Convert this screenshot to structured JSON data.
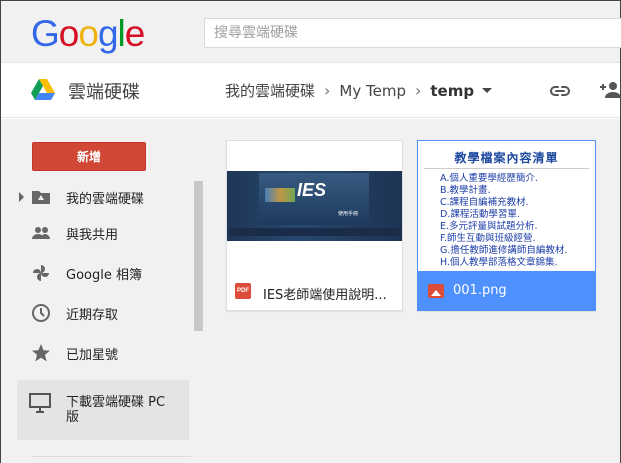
{
  "header": {
    "logo_letters": [
      {
        "ch": "G",
        "color": "#3369e8"
      },
      {
        "ch": "o",
        "color": "#d50f25"
      },
      {
        "ch": "o",
        "color": "#eeb211"
      },
      {
        "ch": "g",
        "color": "#3369e8"
      },
      {
        "ch": "l",
        "color": "#009925"
      },
      {
        "ch": "e",
        "color": "#d50f25"
      }
    ],
    "search_placeholder": "搜尋雲端硬碟"
  },
  "appbar": {
    "title": "雲端硬碟",
    "breadcrumbs": [
      "我的雲端硬碟",
      "My Temp",
      "temp"
    ],
    "link_icon": "link-icon",
    "share_icon": "person-add-icon"
  },
  "sidebar": {
    "new_label": "新增",
    "items": [
      {
        "label": "我的雲端硬碟",
        "icon": "folder-drive-icon"
      },
      {
        "label": "與我共用",
        "icon": "people-icon"
      },
      {
        "label": "Google 相簿",
        "icon": "pinwheel-icon"
      },
      {
        "label": "近期存取",
        "icon": "clock-icon"
      },
      {
        "label": "已加星號",
        "icon": "star-icon"
      }
    ],
    "download_label": "下載雲端硬碟 PC 版",
    "download_icon": "monitor-icon"
  },
  "files": [
    {
      "name": "IES老師端使用說明...",
      "type_badge": "PDF",
      "thumb": {
        "brand": "IES",
        "subtitle": "使用手冊"
      }
    },
    {
      "name": "001.png",
      "selected": true,
      "thumb": {
        "heading": "教學檔案內容清單",
        "items": [
          "A.個人重要學經歷簡介.",
          "B.教學計畫.",
          "C.課程自編補充教材.",
          "D.課程活動學習單.",
          "E.多元評量與試題分析.",
          "F.師生互動與班級經營.",
          "G.擔任教師進修講師自編教材.",
          "H.個人教學部落格文章錦集."
        ]
      }
    }
  ],
  "colors": {
    "new_button": "#d14836",
    "selection": "#4d90fe",
    "background": "#f1f1f1"
  }
}
